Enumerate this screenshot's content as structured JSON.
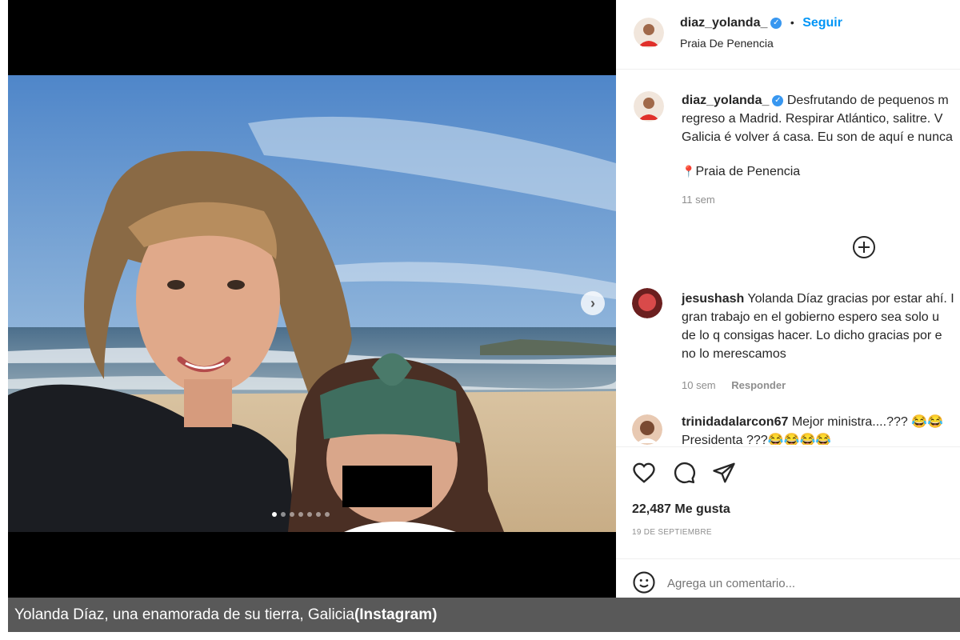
{
  "post": {
    "username": "diaz_yolanda_",
    "separator": "•",
    "follow_label": "Seguir",
    "location": "Praia De Penencia",
    "caption_lines": [
      "Desfrutando de pequenos m",
      "regreso a Madrid. Respirar Atlántico, salitre. V",
      "Galicia é volver á casa. Eu son de aquí e nunca"
    ],
    "caption_location": "Praia de Penencia",
    "caption_time": "11 sem",
    "likes": "22,487 Me gusta",
    "date": "19 DE SEPTIEMBRE",
    "comment_placeholder": "Agrega un comentario..."
  },
  "comments": [
    {
      "username": "jesushash",
      "lines": [
        "Yolanda Díaz gracias por estar ahí. I",
        "gran trabajo en el gobierno espero sea solo u",
        "de lo q consigas hacer. Lo dicho gracias por e",
        "no lo merescamos"
      ],
      "time": "10 sem",
      "reply_label": "Responder"
    },
    {
      "username": "trinidadalarcon67",
      "lines": [
        "Mejor ministra....??? 😂😂",
        "Presidenta ???😂😂😂😂"
      ]
    }
  ],
  "carousel": {
    "slide_count": 7,
    "active_index": 0
  },
  "icons": [
    "verified-icon",
    "plus-circle-icon",
    "chevron-right-icon",
    "heart-icon",
    "comment-icon",
    "share-icon",
    "emoji-icon",
    "location-pin-icon"
  ],
  "colors": {
    "link_blue": "#0095f6",
    "verified_blue": "#3897f0",
    "caption_bar": "#595959",
    "muted": "#8e8e8e"
  },
  "image_caption": {
    "text": "Yolanda Díaz, una enamorada de su tierra, Galicia",
    "source": "(Instagram)"
  }
}
